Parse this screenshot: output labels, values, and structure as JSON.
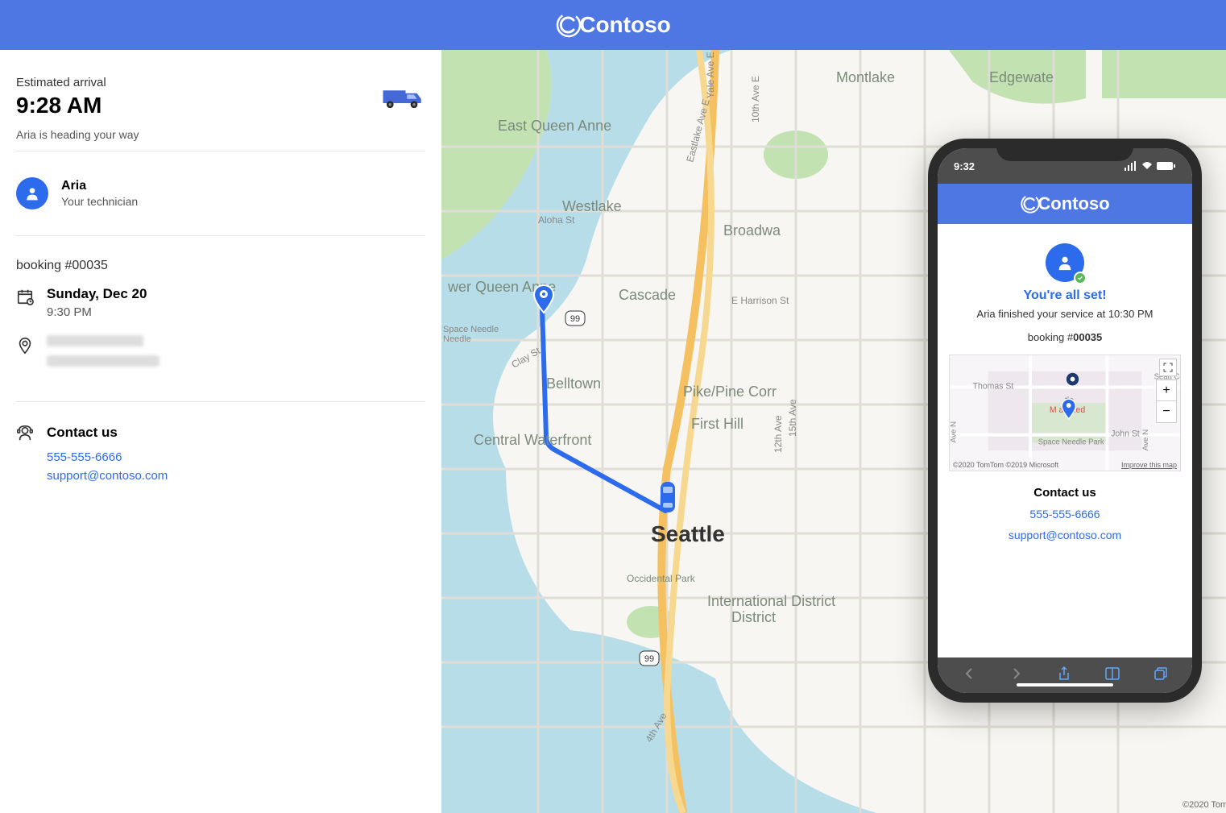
{
  "brand": "Contoso",
  "eta": {
    "label": "Estimated arrival",
    "time": "9:28 AM",
    "status": "Aria is heading your way"
  },
  "technician": {
    "name": "Aria",
    "role": "Your technician"
  },
  "booking": {
    "label": "booking #00035",
    "date": "Sunday, Dec 20",
    "time": "9:30 PM"
  },
  "contact": {
    "title": "Contact us",
    "phone": "555-555-6666",
    "email": "support@contoso.com"
  },
  "map": {
    "city_label": "Seattle",
    "areas": [
      "East Queen Anne",
      "wer Queen Anne",
      "Westlake",
      "Belltown",
      "Central Waterfront",
      "Cascade",
      "Broadwa",
      "First Hill",
      "Pike/Pine Corr",
      "International District",
      "Montlake",
      "Edgewate",
      "Occidental Park"
    ],
    "streets": [
      "Aloha St",
      "Clay St",
      "E Harrison St",
      "10th Ave E",
      "Eastlake Ave E",
      "Yale Ave E",
      "Space Needle",
      "12th Ave",
      "4th Ave",
      "15th Ave"
    ],
    "highway_labels": [
      "99",
      "99"
    ],
    "attribution": "©2020 Tom"
  },
  "phone": {
    "status_time": "9:32",
    "header_brand": "Contoso",
    "set_title": "You're all set!",
    "finished_text": "Aria finished your service at 10:30 PM",
    "booking_prefix": "booking #",
    "booking_number": "00035",
    "contact_title": "Contact us",
    "contact_phone": "555-555-6666",
    "contact_email": "support@contoso.com",
    "map": {
      "attribution": "©2020 TomTom ©2019 Microsoft",
      "improve": "Improve this map",
      "streets": [
        "Thomas St",
        "John St",
        "Ave N",
        "Ave N"
      ],
      "places": [
        "tle",
        "M     ail Red",
        "Space Needle Park",
        "Seatt Cent"
      ]
    }
  }
}
